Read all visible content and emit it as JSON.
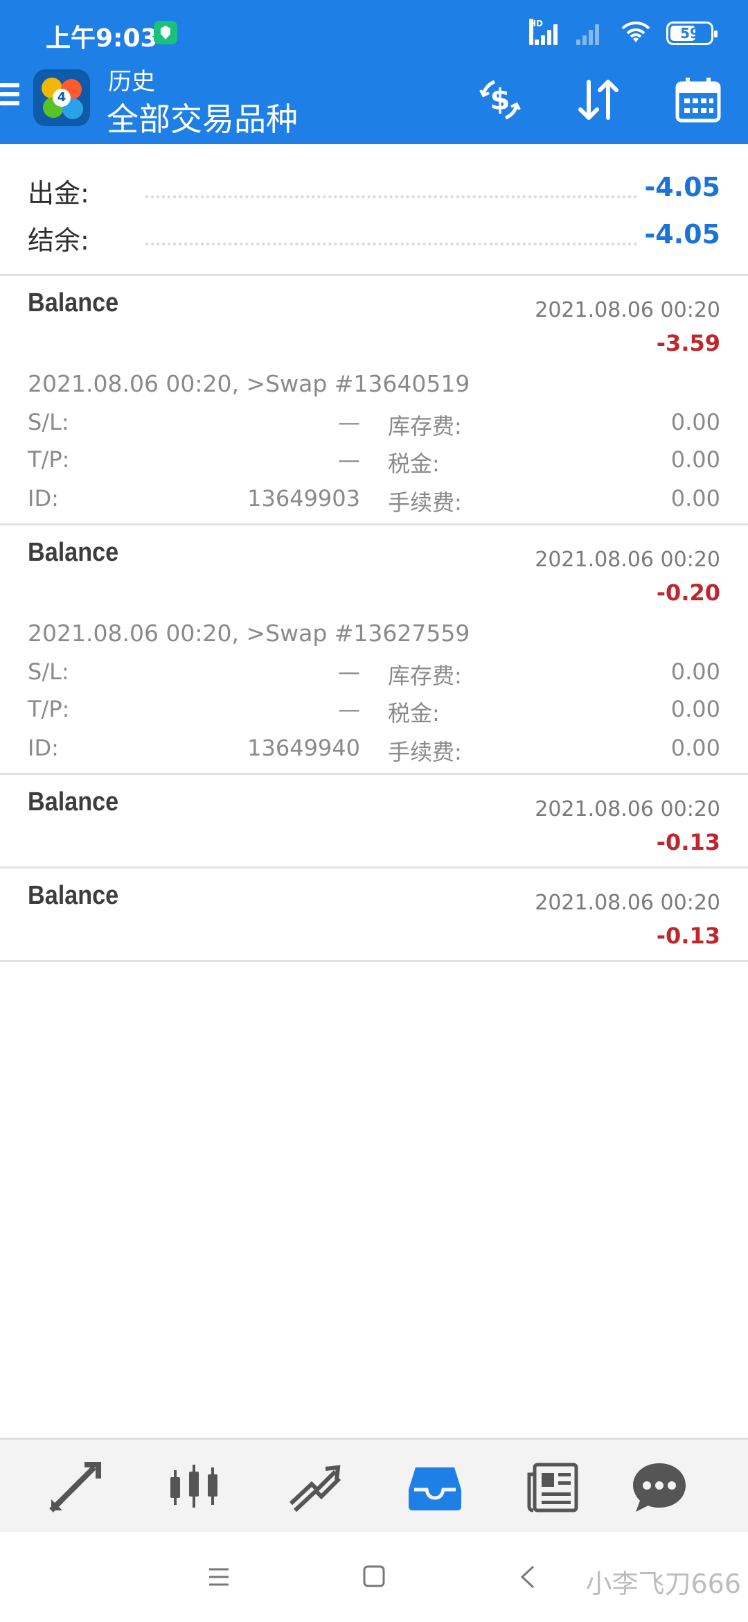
{
  "status_bar": {
    "time": "上午9:03",
    "hd_label": "HD",
    "battery": "59"
  },
  "header": {
    "subtitle": "历史",
    "title": "全部交易品种"
  },
  "summary": {
    "rows": [
      {
        "label": "出金:",
        "value": "-4.05"
      },
      {
        "label": "结余:",
        "value": "-4.05"
      }
    ]
  },
  "records": [
    {
      "type": "Balance",
      "time": "2021.08.06 00:20",
      "amount": "-3.59",
      "comment": "2021.08.06 00:20, >Swap #13640519",
      "sl_label": "S/L:",
      "sl_value": "—",
      "tp_label": "T/P:",
      "tp_value": "—",
      "id_label": "ID:",
      "id_value": "13649903",
      "storage_label": "库存费:",
      "storage_value": "0.00",
      "tax_label": "税金:",
      "tax_value": "0.00",
      "fee_label": "手续费:",
      "fee_value": "0.00"
    },
    {
      "type": "Balance",
      "time": "2021.08.06 00:20",
      "amount": "-0.20",
      "comment": "2021.08.06 00:20, >Swap #13627559",
      "sl_label": "S/L:",
      "sl_value": "—",
      "tp_label": "T/P:",
      "tp_value": "—",
      "id_label": "ID:",
      "id_value": "13649940",
      "storage_label": "库存费:",
      "storage_value": "0.00",
      "tax_label": "税金:",
      "tax_value": "0.00",
      "fee_label": "手续费:",
      "fee_value": "0.00"
    },
    {
      "type": "Balance",
      "time": "2021.08.06 00:20",
      "amount": "-0.13"
    },
    {
      "type": "Balance",
      "time": "2021.08.06 00:20",
      "amount": "-0.13"
    }
  ],
  "bottom_nav": {
    "items": [
      "quotes-icon",
      "chart-icon",
      "trade-icon",
      "history-icon",
      "news-icon",
      "chat-icon"
    ],
    "active_color": "#1e7fe6",
    "inactive_color": "#555555"
  },
  "watermark": "小李飞刀666",
  "colors": {
    "header": "#1e7fe6",
    "positive_blue": "#1a73d9",
    "negative_red": "#c0262d"
  }
}
